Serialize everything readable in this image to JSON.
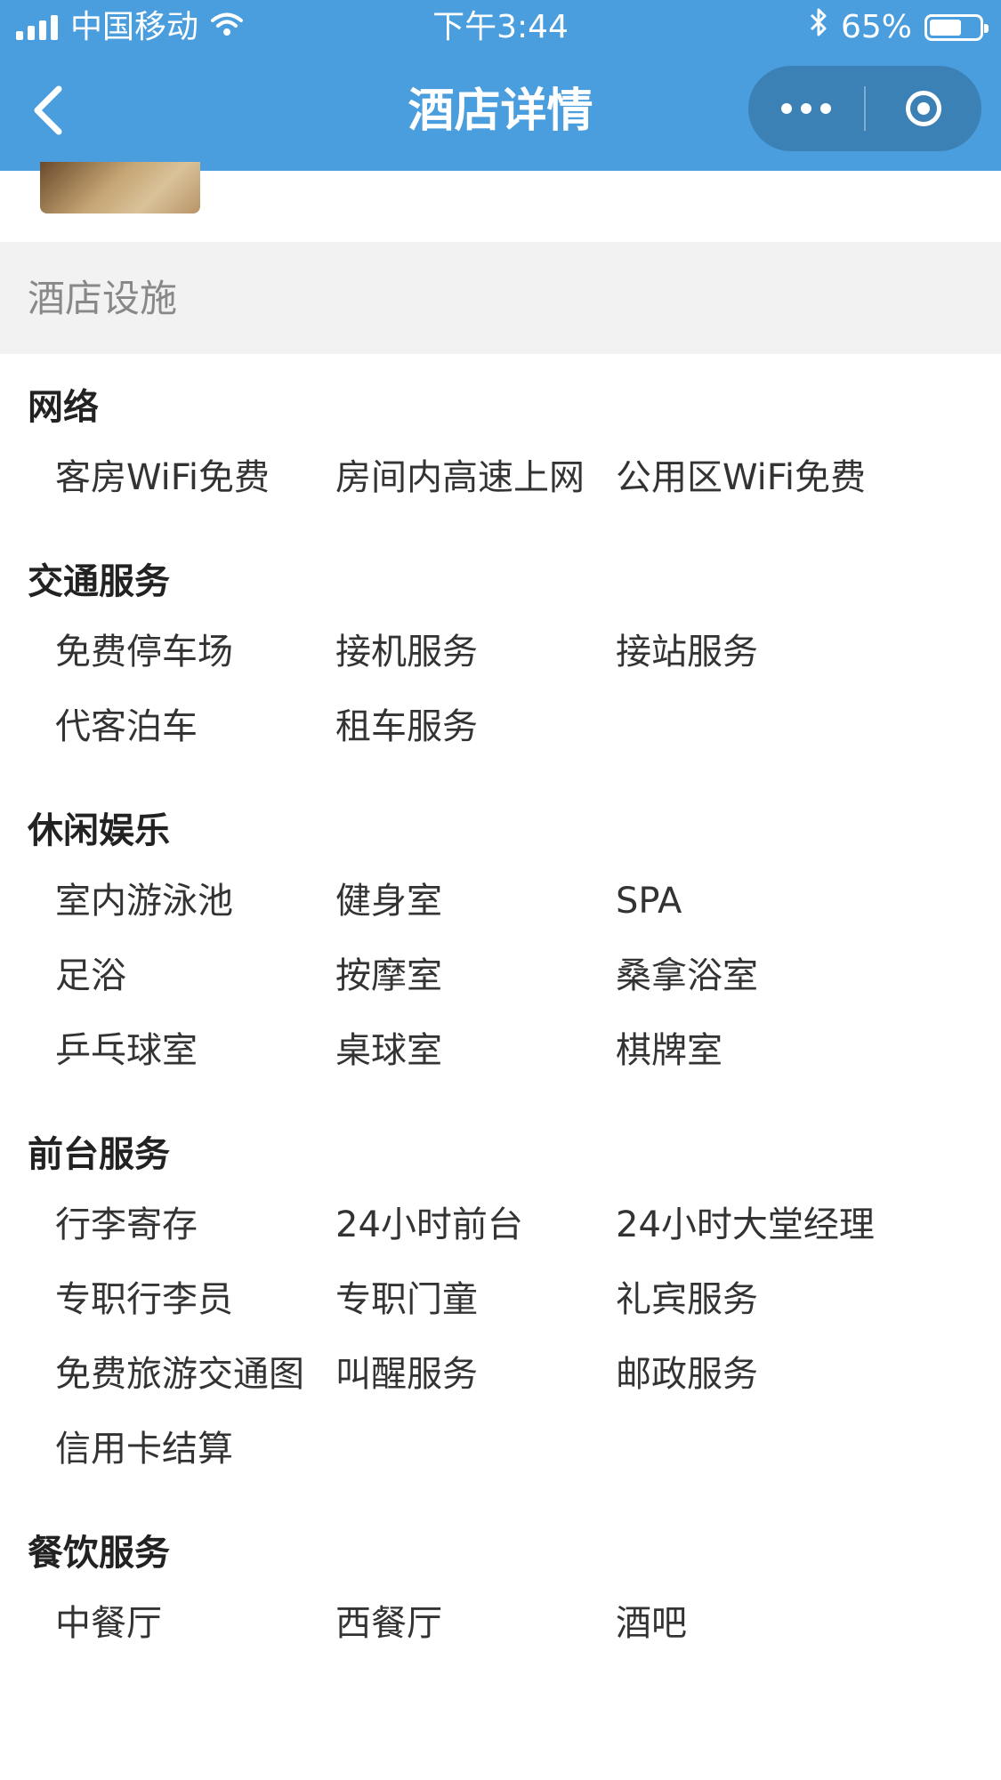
{
  "status_bar": {
    "carrier": "中国移动",
    "time": "下午3:44",
    "battery_text": "65%",
    "battery_level": 0.65
  },
  "nav": {
    "title": "酒店详情"
  },
  "section": {
    "title": "酒店设施"
  },
  "groups": [
    {
      "title": "网络",
      "items": [
        "客房WiFi免费",
        "房间内高速上网",
        "公用区WiFi免费"
      ]
    },
    {
      "title": "交通服务",
      "items": [
        "免费停车场",
        "接机服务",
        "接站服务",
        "代客泊车",
        "租车服务"
      ]
    },
    {
      "title": "休闲娱乐",
      "items": [
        "室内游泳池",
        "健身室",
        "SPA",
        "足浴",
        "按摩室",
        "桑拿浴室",
        "乒乓球室",
        "桌球室",
        "棋牌室"
      ]
    },
    {
      "title": "前台服务",
      "items": [
        "行李寄存",
        "24小时前台",
        "24小时大堂经理",
        "专职行李员",
        "专职门童",
        "礼宾服务",
        "免费旅游交通图",
        "叫醒服务",
        "邮政服务",
        "信用卡结算"
      ]
    },
    {
      "title": "餐饮服务",
      "items": [
        "中餐厅",
        "西餐厅",
        "酒吧"
      ]
    }
  ],
  "colors": {
    "nav_bg": "#4a9ede",
    "section_bg": "#f2f2f2"
  },
  "icons": {
    "back": "chevron-left-icon",
    "more": "more-dots-icon",
    "home": "target-icon",
    "wifi": "wifi-icon",
    "bluetooth": "bluetooth-icon",
    "battery": "battery-icon",
    "signal": "signal-icon"
  }
}
